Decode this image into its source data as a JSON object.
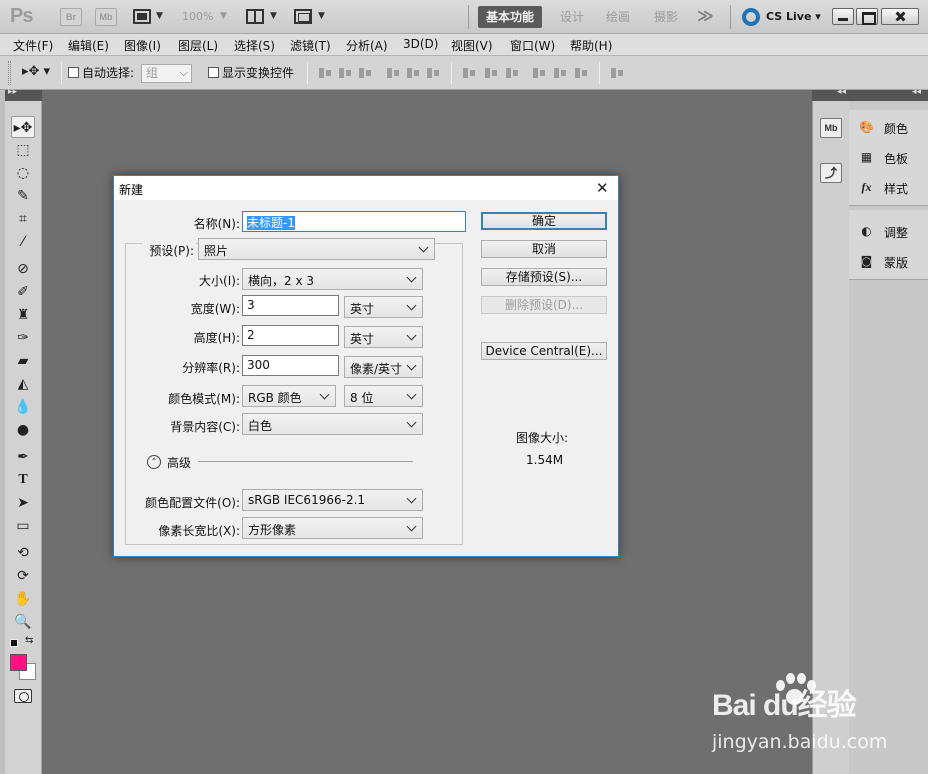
{
  "appbar": {
    "logo": "Ps",
    "bridge": "Br",
    "mini_bridge": "Mb",
    "zoom": "100%",
    "workspaces": [
      "基本功能",
      "设计",
      "绘画",
      "摄影"
    ],
    "more": "≫",
    "cs_live": "CS Live ▾"
  },
  "menu": [
    "文件(F)",
    "编辑(E)",
    "图像(I)",
    "图层(L)",
    "选择(S)",
    "滤镜(T)",
    "分析(A)",
    "3D(D)",
    "视图(V)",
    "窗口(W)",
    "帮助(H)"
  ],
  "options": {
    "auto_select_label": "自动选择:",
    "auto_select_value": "组",
    "show_transform_label": "显示变换控件"
  },
  "right_panels": {
    "group1": [
      "颜色",
      "色板",
      "样式"
    ],
    "group2": [
      "调整",
      "蒙版"
    ],
    "strip_label": "Mb"
  },
  "colors": {
    "foreground": "#ff0f84",
    "background": "#ffffff",
    "accent": "#3c7fb1"
  },
  "dialog": {
    "title": "新建",
    "name_label": "名称(N):",
    "name_value": "未标题-1",
    "preset_label": "预设(P):",
    "preset_value": "照片",
    "size_label": "大小(I):",
    "size_value": "横向，2 x 3",
    "width_label": "宽度(W):",
    "width_value": "3",
    "width_unit": "英寸",
    "height_label": "高度(H):",
    "height_value": "2",
    "height_unit": "英寸",
    "resolution_label": "分辨率(R):",
    "resolution_value": "300",
    "resolution_unit": "像素/英寸",
    "color_mode_label": "颜色模式(M):",
    "color_mode_value": "RGB 颜色",
    "bit_depth_value": "8 位",
    "background_label": "背景内容(C):",
    "background_value": "白色",
    "advanced_label": "高级",
    "profile_label": "颜色配置文件(O):",
    "profile_value": "sRGB IEC61966-2.1",
    "pixel_aspect_label": "像素长宽比(X):",
    "pixel_aspect_value": "方形像素",
    "buttons": {
      "ok": "确定",
      "cancel": "取消",
      "save_preset": "存储预设(S)...",
      "delete_preset": "删除预设(D)...",
      "device_central": "Device Central(E)..."
    },
    "image_size_label": "图像大小:",
    "image_size_value": "1.54M"
  },
  "watermark": {
    "brand": "Bai  du经验",
    "url": "jingyan.baidu.com"
  }
}
